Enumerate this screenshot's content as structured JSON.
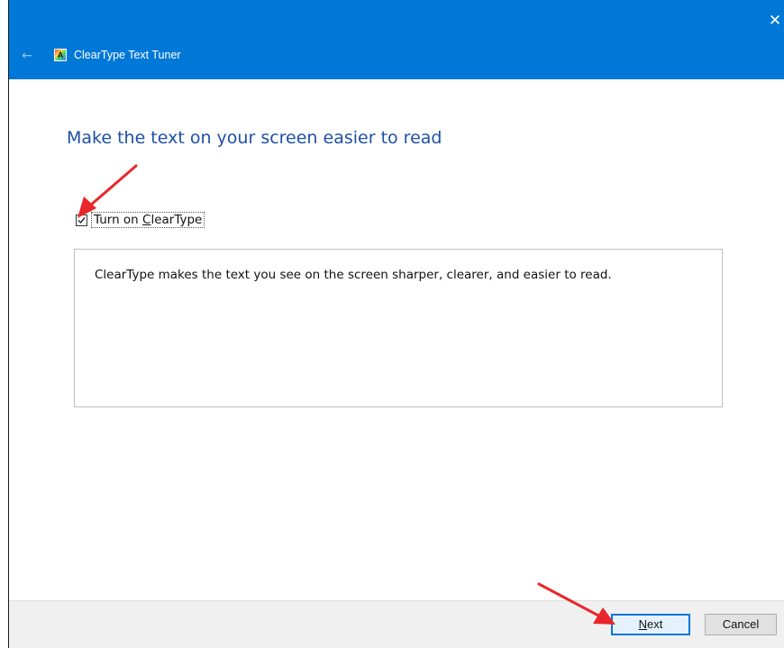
{
  "window": {
    "title": "ClearType Text Tuner",
    "app_icon_letter": "A",
    "close_glyph": "✕",
    "back_glyph": "←"
  },
  "page": {
    "heading": "Make the text on your screen easier to read"
  },
  "option": {
    "label_prefix": "Turn on ",
    "label_accel": "C",
    "label_rest": "learType",
    "checked": true
  },
  "description": {
    "text": "ClearType makes the text you see on the screen sharper, clearer, and easier to read."
  },
  "footer": {
    "next_accel": "N",
    "next_rest": "ext",
    "cancel_label": "Cancel"
  },
  "colors": {
    "titlebar": "#0078d7",
    "heading": "#1e4fa5",
    "annotation_arrow": "#e8262b"
  },
  "icons": [
    "back-arrow-icon",
    "cleartype-app-icon",
    "close-icon",
    "checkmark-icon",
    "annotation-arrow-icon"
  ]
}
